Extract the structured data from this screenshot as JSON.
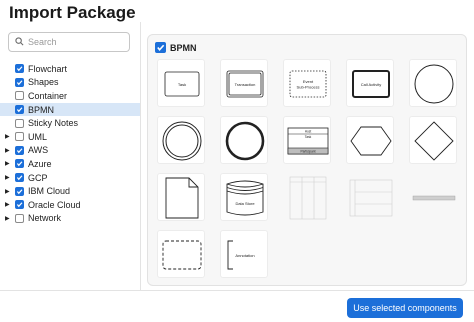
{
  "dialog": {
    "title": "Import Package"
  },
  "search": {
    "placeholder": "Search",
    "value": ""
  },
  "tree": {
    "items": [
      {
        "label": "Flowchart",
        "checked": true,
        "expandable": false,
        "selected": false
      },
      {
        "label": "Shapes",
        "checked": true,
        "expandable": false,
        "selected": false
      },
      {
        "label": "Container",
        "checked": false,
        "expandable": false,
        "selected": false
      },
      {
        "label": "BPMN",
        "checked": true,
        "expandable": false,
        "selected": true
      },
      {
        "label": "Sticky Notes",
        "checked": false,
        "expandable": false,
        "selected": false
      },
      {
        "label": "UML",
        "checked": false,
        "expandable": true,
        "selected": false
      },
      {
        "label": "AWS",
        "checked": true,
        "expandable": true,
        "selected": false
      },
      {
        "label": "Azure",
        "checked": true,
        "expandable": true,
        "selected": false
      },
      {
        "label": "GCP",
        "checked": true,
        "expandable": true,
        "selected": false
      },
      {
        "label": "IBM Cloud",
        "checked": true,
        "expandable": true,
        "selected": false
      },
      {
        "label": "Oracle Cloud",
        "checked": true,
        "expandable": true,
        "selected": false
      },
      {
        "label": "Network",
        "checked": false,
        "expandable": true,
        "selected": false
      }
    ]
  },
  "panel": {
    "header_label": "BPMN",
    "header_checked": true,
    "shapes": [
      {
        "name": "task",
        "label": "Task"
      },
      {
        "name": "transaction",
        "label": "Transaction"
      },
      {
        "name": "event-sub-process",
        "label": "Event Sub-Process"
      },
      {
        "name": "call-activity",
        "label": "Call Activity"
      },
      {
        "name": "start-event",
        "label": ""
      },
      {
        "name": "intermediate-event",
        "label": ""
      },
      {
        "name": "end-event",
        "label": ""
      },
      {
        "name": "pool-task",
        "label": "Host Task",
        "label2": "Participant"
      },
      {
        "name": "conversation",
        "label": ""
      },
      {
        "name": "gateway",
        "label": ""
      },
      {
        "name": "data-object",
        "label": ""
      },
      {
        "name": "data-store",
        "label": "Data Store"
      },
      {
        "name": "lane-vertical",
        "label": ""
      },
      {
        "name": "lane-horizontal",
        "label": ""
      },
      {
        "name": "pool-horizontal",
        "label": ""
      },
      {
        "name": "group",
        "label": ""
      },
      {
        "name": "annotation",
        "label": "Annotation"
      }
    ]
  },
  "footer": {
    "primary_label": "Use selected components"
  },
  "colors": {
    "accent": "#1c6fd9",
    "selected_row": "#d7e6f7"
  }
}
